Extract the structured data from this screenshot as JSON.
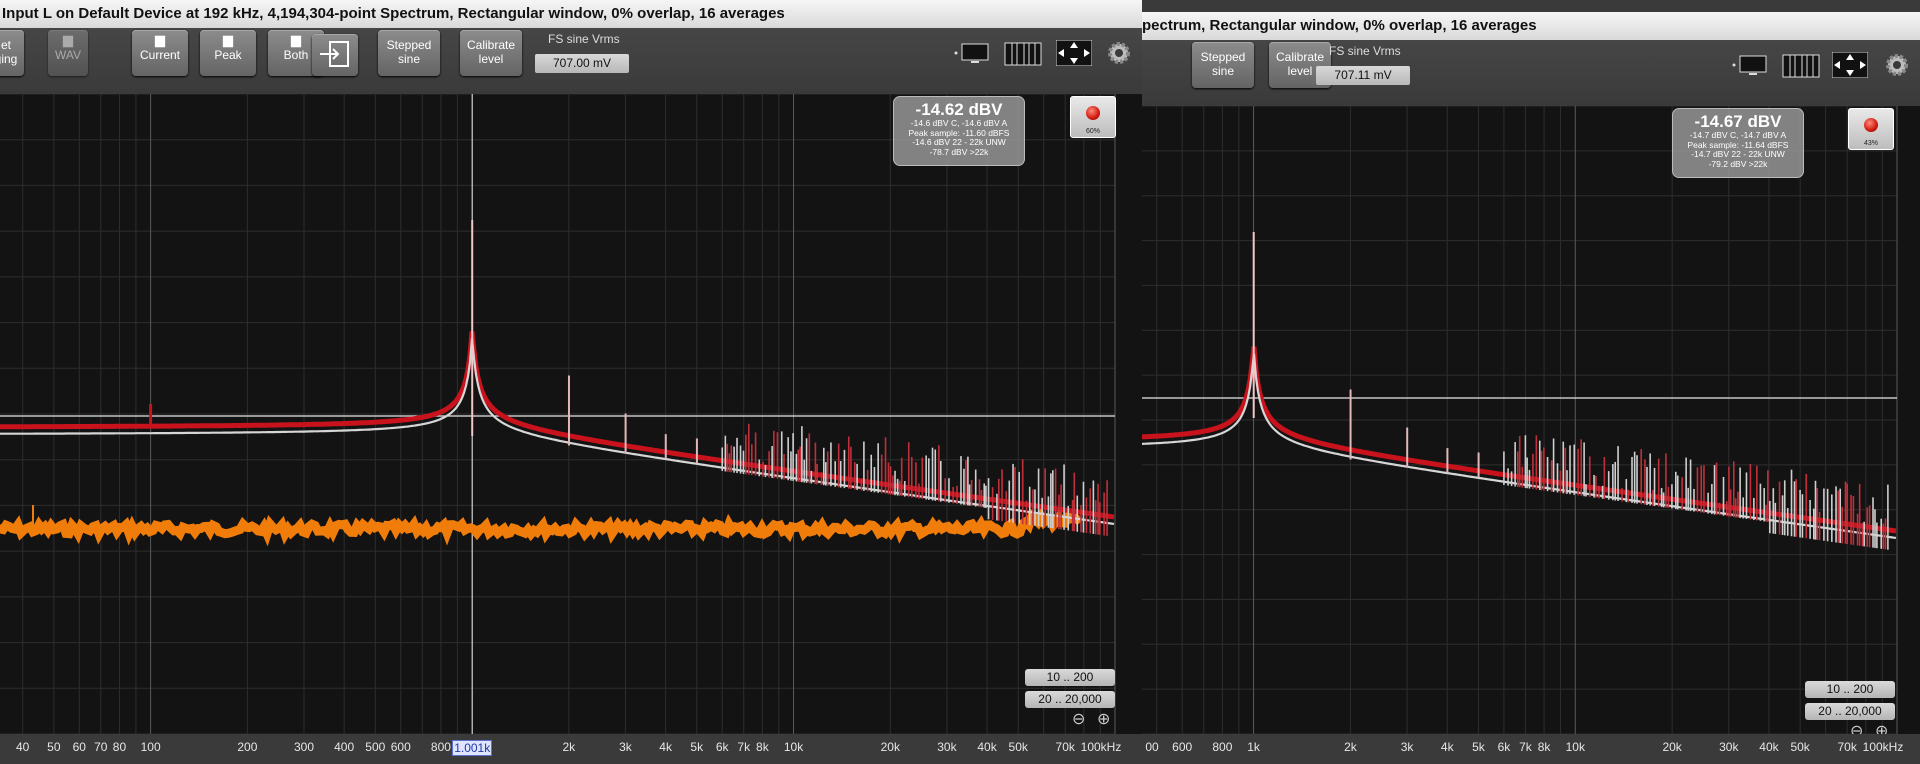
{
  "windows": [
    {
      "title": "Input L on Default Device at 192 kHz, 4,194,304-point Spectrum, Rectangular window, 0% overlap, 16 averages",
      "toolbar": {
        "partial_button_lines": [
          "et",
          "ging"
        ],
        "wav_label": "WAV",
        "current_label": "Current",
        "peak_label": "Peak",
        "both_label": "Both",
        "stepped_sine_label": "Stepped\nsine",
        "calibrate_label": "Calibrate\nlevel",
        "fs_label": "FS sine Vrms",
        "fs_value": "707.00 mV"
      },
      "meter": {
        "main": "-14.62 dBV",
        "lines": [
          "-14.6 dBV C, -14.6 dBV A",
          "Peak sample: -11.60 dBFS",
          "-14.6 dBV 22 - 22k UNW",
          "-78.7 dBV >22k"
        ]
      },
      "led": {
        "percent": "60%"
      },
      "range_buttons": [
        "10 .. 200",
        "20 .. 20,000"
      ],
      "axis_ticks": [
        "40",
        "50",
        "60",
        "70",
        "80",
        "100",
        "200",
        "300",
        "400",
        "500",
        "600",
        "800",
        "1.001k",
        "2k",
        "3k",
        "4k",
        "5k",
        "6k",
        "7k",
        "8k",
        "10k",
        "20k",
        "30k",
        "40k",
        "50k",
        "70k",
        "100kHz"
      ],
      "highlighted_tick": "1.001k"
    },
    {
      "title": "pectrum, Rectangular window, 0% overlap, 16 averages",
      "toolbar": {
        "stepped_sine_label": "Stepped\nsine",
        "calibrate_label": "Calibrate\nlevel",
        "fs_label": "FS sine Vrms",
        "fs_value": "707.11 mV"
      },
      "meter": {
        "main": "-14.67 dBV",
        "lines": [
          "-14.7 dBV C, -14.7 dBV A",
          "Peak sample: -11.64 dBFS",
          "-14.7 dBV 22 - 22k UNW",
          "-79.2 dBV >22k"
        ]
      },
      "led": {
        "percent": "43%"
      },
      "range_buttons": [
        "10 .. 200",
        "20 .. 20,000"
      ],
      "axis_ticks": [
        "00",
        "600",
        "800",
        "1k",
        "2k",
        "3k",
        "4k",
        "5k",
        "6k",
        "7k",
        "8k",
        "10k",
        "20k",
        "30k",
        "40k",
        "50k",
        "70k",
        "100kHz"
      ]
    }
  ],
  "colors": {
    "peak_trace": "#c8121c",
    "current_trace": "#d6d6d6",
    "noise_trace": "#f07c0a",
    "plot_bg": "#131313"
  },
  "icons": [
    "save-icon",
    "monitor-icon",
    "grid-icon",
    "fit-arrows-icon",
    "gear-icon",
    "zoom-out-icon",
    "zoom-in-icon"
  ]
}
